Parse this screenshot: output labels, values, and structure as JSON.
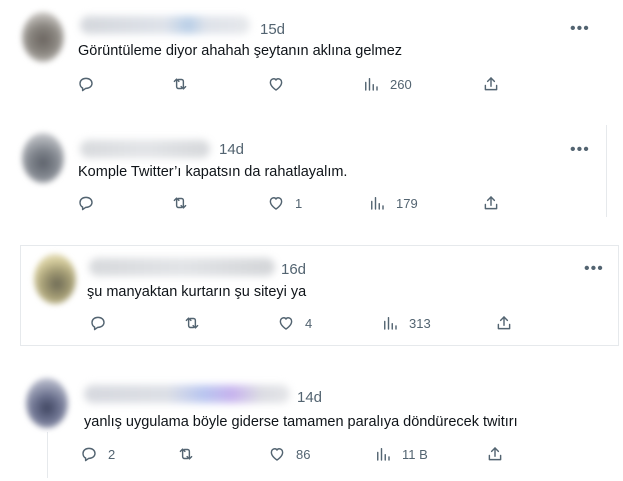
{
  "tweets": [
    {
      "time": "15d",
      "text": "Görüntüleme diyor ahahah şeytanın aklına gelmez",
      "likes": "",
      "views": "260",
      "replies": ""
    },
    {
      "time": "14d",
      "text": "Komple Twitter’ı kapatsın da rahatlayalım.",
      "likes": "1",
      "views": "179",
      "replies": ""
    },
    {
      "time": "16d",
      "text": "şu manyaktan kurtarın şu siteyi ya",
      "likes": "4",
      "views": "313",
      "replies": ""
    },
    {
      "time": "14d",
      "text": "yanlış uygulama böyle giderse tamamen paralıya döndürecek twitırı",
      "likes": "86",
      "views": "11 B",
      "replies": "2"
    }
  ],
  "icons": {
    "more": "more-horizontal-icon",
    "reply": "reply-icon",
    "retweet": "retweet-icon",
    "like": "heart-icon",
    "views": "views-chart-icon",
    "share": "share-icon"
  },
  "colors": {
    "text": "#0f1419",
    "muted": "#536471",
    "border": "#e6e9ec"
  }
}
